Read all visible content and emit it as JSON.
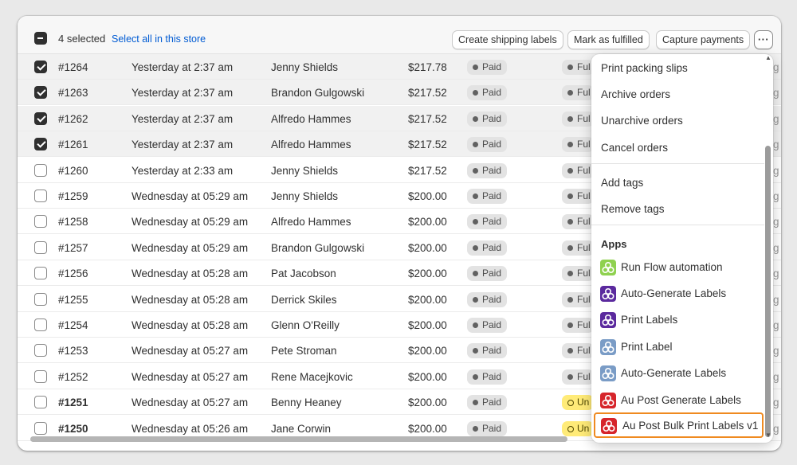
{
  "bulk": {
    "selected_text": "4 selected",
    "select_all_link": "Select all in this store",
    "buttons": {
      "create_labels": "Create shipping labels",
      "mark_fulfilled": "Mark as fulfilled",
      "capture_payments": "Capture payments",
      "more": "···"
    }
  },
  "orders": [
    {
      "id": "#1264",
      "date": "Yesterday at 2:37 am",
      "customer": "Jenny Shields",
      "total": "$217.78",
      "payment": "Paid",
      "fulfillment": "Ful",
      "selected": true,
      "bold": false
    },
    {
      "id": "#1263",
      "date": "Yesterday at 2:37 am",
      "customer": "Brandon Gulgowski",
      "total": "$217.52",
      "payment": "Paid",
      "fulfillment": "Ful",
      "selected": true,
      "bold": false
    },
    {
      "id": "#1262",
      "date": "Yesterday at 2:37 am",
      "customer": "Alfredo Hammes",
      "total": "$217.52",
      "payment": "Paid",
      "fulfillment": "Ful",
      "selected": true,
      "bold": false
    },
    {
      "id": "#1261",
      "date": "Yesterday at 2:37 am",
      "customer": "Alfredo Hammes",
      "total": "$217.52",
      "payment": "Paid",
      "fulfillment": "Ful",
      "selected": true,
      "bold": false
    },
    {
      "id": "#1260",
      "date": "Yesterday at 2:33 am",
      "customer": "Jenny Shields",
      "total": "$217.52",
      "payment": "Paid",
      "fulfillment": "Ful",
      "selected": false,
      "bold": false
    },
    {
      "id": "#1259",
      "date": "Wednesday at 05:29 am",
      "customer": "Jenny Shields",
      "total": "$200.00",
      "payment": "Paid",
      "fulfillment": "Ful",
      "selected": false,
      "bold": false
    },
    {
      "id": "#1258",
      "date": "Wednesday at 05:29 am",
      "customer": "Alfredo Hammes",
      "total": "$200.00",
      "payment": "Paid",
      "fulfillment": "Ful",
      "selected": false,
      "bold": false
    },
    {
      "id": "#1257",
      "date": "Wednesday at 05:29 am",
      "customer": "Brandon Gulgowski",
      "total": "$200.00",
      "payment": "Paid",
      "fulfillment": "Ful",
      "selected": false,
      "bold": false
    },
    {
      "id": "#1256",
      "date": "Wednesday at 05:28 am",
      "customer": "Pat Jacobson",
      "total": "$200.00",
      "payment": "Paid",
      "fulfillment": "Ful",
      "selected": false,
      "bold": false
    },
    {
      "id": "#1255",
      "date": "Wednesday at 05:28 am",
      "customer": "Derrick Skiles",
      "total": "$200.00",
      "payment": "Paid",
      "fulfillment": "Ful",
      "selected": false,
      "bold": false
    },
    {
      "id": "#1254",
      "date": "Wednesday at 05:28 am",
      "customer": "Glenn O'Reilly",
      "total": "$200.00",
      "payment": "Paid",
      "fulfillment": "Ful",
      "selected": false,
      "bold": false
    },
    {
      "id": "#1253",
      "date": "Wednesday at 05:27 am",
      "customer": "Pete Stroman",
      "total": "$200.00",
      "payment": "Paid",
      "fulfillment": "Ful",
      "selected": false,
      "bold": false
    },
    {
      "id": "#1252",
      "date": "Wednesday at 05:27 am",
      "customer": "Rene Macejkovic",
      "total": "$200.00",
      "payment": "Paid",
      "fulfillment": "Ful",
      "selected": false,
      "bold": false
    },
    {
      "id": "#1251",
      "date": "Wednesday at 05:27 am",
      "customer": "Benny Heaney",
      "total": "$200.00",
      "payment": "Paid",
      "fulfillment": "Un",
      "selected": false,
      "bold": true
    },
    {
      "id": "#1250",
      "date": "Wednesday at 05:26 am",
      "customer": "Jane Corwin",
      "total": "$200.00",
      "payment": "Paid",
      "fulfillment": "Un",
      "selected": false,
      "bold": true
    }
  ],
  "row_edge_char": "g",
  "menu": {
    "group1": [
      "Print packing slips",
      "Archive orders",
      "Unarchive orders",
      "Cancel orders"
    ],
    "group2": [
      "Add tags",
      "Remove tags"
    ],
    "apps_heading": "Apps",
    "apps": [
      {
        "label": "Run Flow automation",
        "icon": "flow-icon",
        "color": "#8fd14f"
      },
      {
        "label": "Auto-Generate Labels",
        "icon": "label-app-icon",
        "color": "#5b2a9e"
      },
      {
        "label": "Print Labels",
        "icon": "label-app-icon",
        "color": "#5b2a9e"
      },
      {
        "label": "Print Label",
        "icon": "label-app-icon",
        "color": "#7a9cc6"
      },
      {
        "label": "Auto-Generate Labels",
        "icon": "label-app-icon",
        "color": "#7a9cc6"
      },
      {
        "label": "Au Post Generate Labels",
        "icon": "auspost-icon",
        "color": "#d6252b"
      },
      {
        "label": "Au Post Bulk Print Labels v1",
        "icon": "auspost-icon",
        "color": "#d6252b",
        "highlighted": true
      }
    ]
  },
  "colors": {
    "link": "#005bd3",
    "highlight_border": "#ef8a20",
    "badge_yellow": "#ffeb78",
    "badge_grey": "#e3e3e3"
  }
}
